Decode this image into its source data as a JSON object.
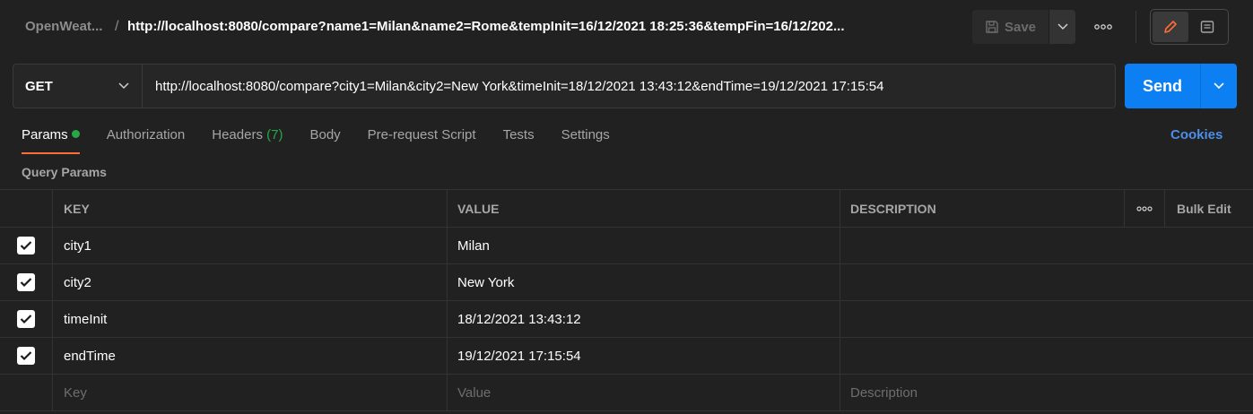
{
  "header": {
    "collection": "OpenWeat...",
    "separator": "/",
    "request_title": "http://localhost:8080/compare?name1=Milan&name2=Rome&tempInit=16/12/2021 18:25:36&tempFin=16/12/202...",
    "save_label": "Save",
    "more_icon": "ellipsis-icon"
  },
  "request": {
    "method": "GET",
    "url": "http://localhost:8080/compare?city1=Milan&city2=New York&timeInit=18/12/2021 13:43:12&endTime=19/12/2021 17:15:54",
    "send_label": "Send"
  },
  "tabs": [
    {
      "label": "Params",
      "active": true,
      "dot": true
    },
    {
      "label": "Authorization"
    },
    {
      "label": "Headers ",
      "count": "(7)"
    },
    {
      "label": "Body"
    },
    {
      "label": "Pre-request Script"
    },
    {
      "label": "Tests"
    },
    {
      "label": "Settings"
    }
  ],
  "cookies_label": "Cookies",
  "query_params": {
    "title": "Query Params",
    "columns": {
      "key": "KEY",
      "value": "VALUE",
      "description": "DESCRIPTION",
      "bulk_edit": "Bulk Edit"
    },
    "rows": [
      {
        "checked": true,
        "key": "city1",
        "value": "Milan",
        "description": ""
      },
      {
        "checked": true,
        "key": "city2",
        "value": "New York",
        "description": ""
      },
      {
        "checked": true,
        "key": "timeInit",
        "value": "18/12/2021 13:43:12",
        "description": ""
      },
      {
        "checked": true,
        "key": "endTime",
        "value": "19/12/2021 17:15:54",
        "description": ""
      }
    ],
    "placeholders": {
      "key": "Key",
      "value": "Value",
      "description": "Description"
    }
  },
  "colors": {
    "accent": "#ff6c37",
    "send": "#0c7ff2",
    "active_dot": "#27a844",
    "link": "#4c8ee8"
  }
}
